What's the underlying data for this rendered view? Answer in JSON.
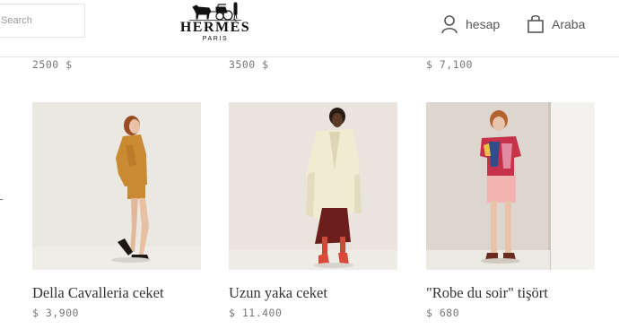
{
  "header": {
    "search_placeholder": "Search",
    "logo": {
      "wordmark": "HERMÈS",
      "sub": "PARIS"
    },
    "account_label": "hesap",
    "cart_label": "Araba"
  },
  "previous_row_prices": [
    "2500 $",
    "3500 $",
    "$ 7,100"
  ],
  "products": [
    {
      "name": "Della Cavalleria ceket",
      "price": "$ 3,900"
    },
    {
      "name": "Uzun yaka ceket",
      "price": "$ 11.400"
    },
    {
      "name": "\"Robe du soir\" tişört",
      "price": "$ 680"
    }
  ],
  "icons": {
    "account": "user-icon",
    "cart": "shopping-bag-icon",
    "logo": "horse-carriage-logo"
  }
}
